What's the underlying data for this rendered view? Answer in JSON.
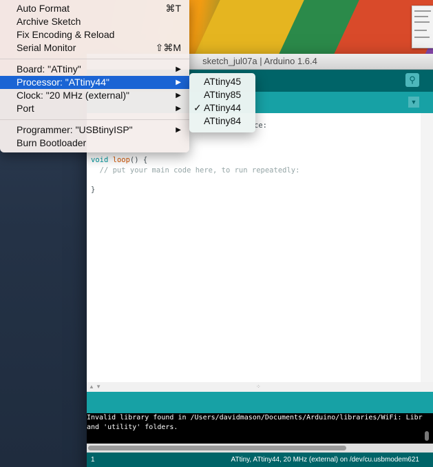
{
  "window": {
    "title": "sketch_jul07a | Arduino 1.6.4"
  },
  "editor": {
    "lines": [
      "ce:",
      "void loop() {",
      "  // put your main code here, to run repeatedly:",
      "}"
    ],
    "loop_keyword": "void",
    "loop_fn": "loop",
    "loop_rest": "() {",
    "comment": "  // put your main code here, to run repeatedly:"
  },
  "console": {
    "line1": "Invalid library found in /Users/davidmason/Documents/Arduino/libraries/WiFi: Libr",
    "line2": "and 'utility' folders."
  },
  "status": {
    "line_number": "1",
    "board_info": "ATtiny, ATtiny44, 20 MHz (external) on /dev/cu.usbmodem621"
  },
  "menu": {
    "items": [
      {
        "label": "Auto Format",
        "shortcut": "⌘T"
      },
      {
        "label": "Archive Sketch",
        "shortcut": ""
      },
      {
        "label": "Fix Encoding & Reload",
        "shortcut": ""
      },
      {
        "label": "Serial Monitor",
        "shortcut": "⇧⌘M"
      },
      {
        "label": "Board: \"ATtiny\"",
        "shortcut": "▶"
      },
      {
        "label": "Processor: \"ATtiny44\"",
        "shortcut": "▶"
      },
      {
        "label": "Clock: \"20 MHz (external)\"",
        "shortcut": "▶"
      },
      {
        "label": "Port",
        "shortcut": "▶"
      },
      {
        "label": "Programmer: \"USBtinyISP\"",
        "shortcut": "▶"
      },
      {
        "label": "Burn Bootloader",
        "shortcut": ""
      }
    ]
  },
  "submenu": {
    "items": [
      {
        "label": "ATtiny45",
        "check": ""
      },
      {
        "label": "ATtiny85",
        "check": ""
      },
      {
        "label": "ATtiny44",
        "check": "✓"
      },
      {
        "label": "ATtiny84",
        "check": ""
      }
    ]
  },
  "colors": {
    "toolbar": "#006468",
    "tabbar": "#17a1a5",
    "menu_highlight": "#1a64d4"
  }
}
